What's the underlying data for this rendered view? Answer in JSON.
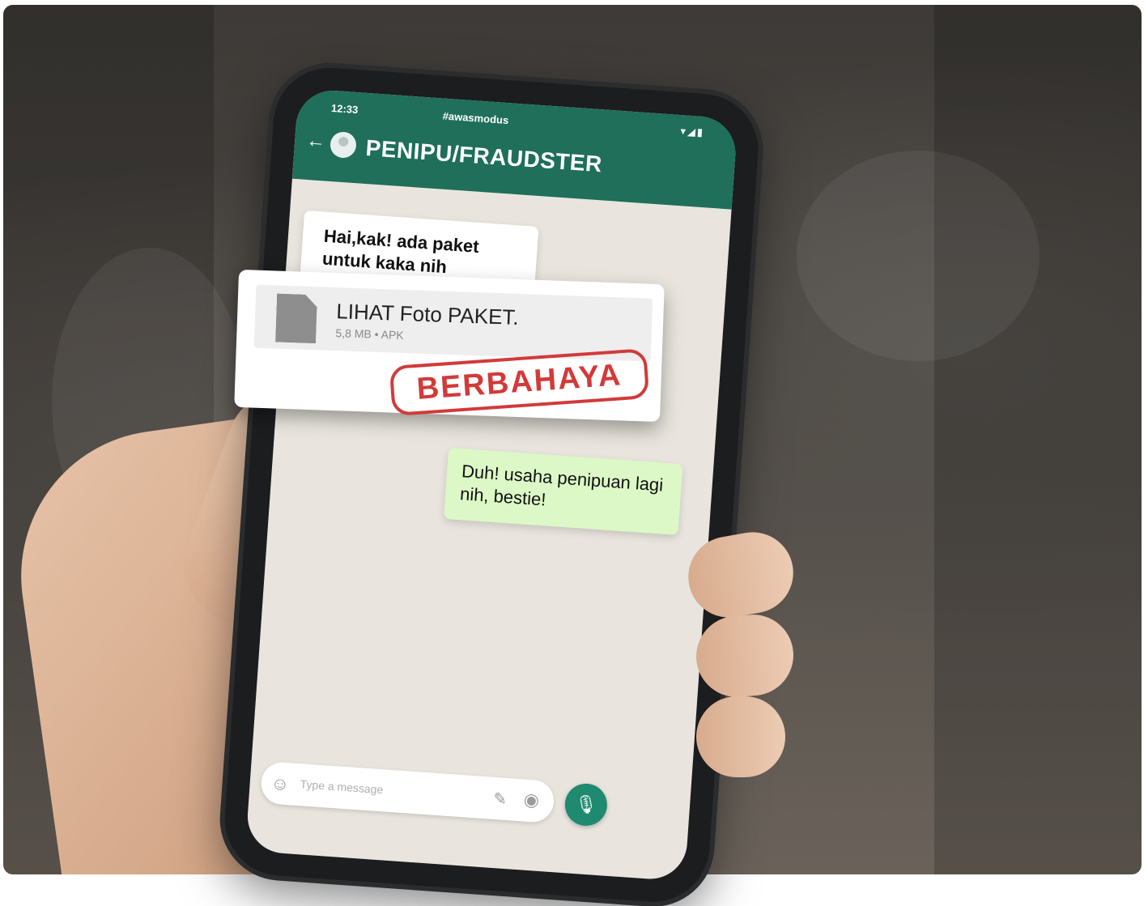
{
  "status_bar": {
    "time": "12:33",
    "hashtag": "#awasmodus",
    "icons": "▾◢▮"
  },
  "header": {
    "back_icon": "←",
    "contact_name": "PENIPU/FRAUDSTER"
  },
  "messages": [
    {
      "direction": "incoming",
      "text": "Hai,kak! ada paket untuk kaka nih"
    },
    {
      "direction": "outgoing",
      "text": "Duh! usaha penipuan lagi nih, bestie!"
    }
  ],
  "attachment": {
    "file_name": "LIHAT Foto PAKET.",
    "file_meta": "5,8 MB • APK",
    "warning_stamp": "BERBAHAYA",
    "stamp_color": "#d23a3a"
  },
  "composer": {
    "placeholder": "Type a message",
    "emoji_icon": "☺",
    "attach_icon": "✎",
    "camera_icon": "◉",
    "mic_icon": "🎙"
  },
  "colors": {
    "header_green": "#1f6f5a",
    "mic_green": "#1f8a70",
    "outgoing_bubble": "#dcf8c6"
  }
}
